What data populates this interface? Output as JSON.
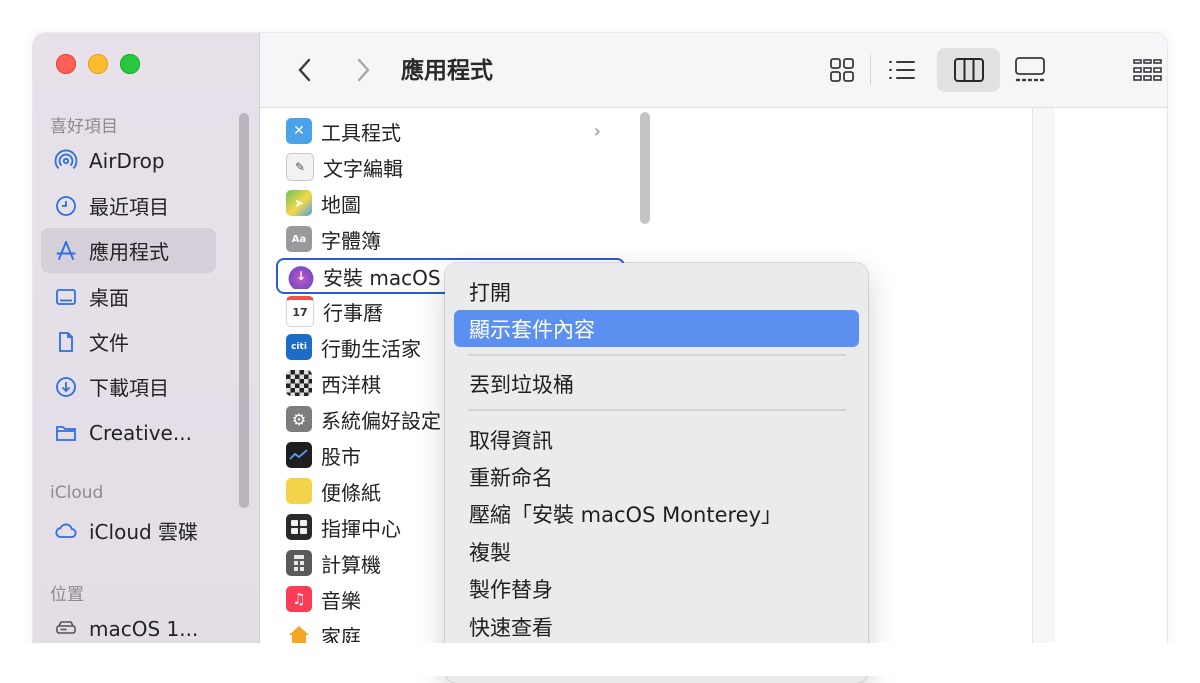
{
  "window": {
    "traffic_lights": {
      "close": "#fe5f57",
      "minimize": "#febc2e",
      "zoom": "#28c840"
    }
  },
  "sidebar": {
    "sections": [
      {
        "title": "喜好項目"
      },
      {
        "title": "iCloud"
      },
      {
        "title": "位置"
      }
    ],
    "items": [
      {
        "label": "AirDrop",
        "icon": "airdrop-icon"
      },
      {
        "label": "最近項目",
        "icon": "clock-icon"
      },
      {
        "label": "應用程式",
        "icon": "apps-icon",
        "selected": true
      },
      {
        "label": "桌面",
        "icon": "desktop-icon"
      },
      {
        "label": "文件",
        "icon": "document-icon"
      },
      {
        "label": "下載項目",
        "icon": "download-icon"
      },
      {
        "label": "Creative...",
        "icon": "folder-icon"
      },
      {
        "label": "iCloud 雲碟",
        "icon": "cloud-icon"
      },
      {
        "label": "macOS 1...",
        "icon": "disk-icon"
      }
    ]
  },
  "toolbar": {
    "title": "應用程式",
    "back": "back-chevron-icon",
    "forward": "forward-chevron-icon",
    "views": [
      "icon-view-icon",
      "list-view-icon",
      "column-view-icon",
      "gallery-view-icon"
    ],
    "selected_view": "column-view-icon",
    "group": "group-icon"
  },
  "files": [
    {
      "name": "工具程式",
      "color": "#4aa3e8"
    },
    {
      "name": "文字編輯",
      "color": "#f2f2f2"
    },
    {
      "name": "地圖",
      "color": "#6cc35a"
    },
    {
      "name": "字體簿",
      "color": "#9a9a9c"
    },
    {
      "name": "安裝 macOS M",
      "color": "#7b4cc2",
      "focused": true
    },
    {
      "name": "行事曆",
      "color": "#ffffff"
    },
    {
      "name": "行動生活家",
      "color": "#1c6cc8"
    },
    {
      "name": "西洋棋",
      "color": "#444444"
    },
    {
      "name": "系統偏好設定",
      "color": "#7d7d80"
    },
    {
      "name": "股市",
      "color": "#1e1e1e"
    },
    {
      "name": "便條紙",
      "color": "#f3d34a"
    },
    {
      "name": "指揮中心",
      "color": "#2a2a2a"
    },
    {
      "name": "計算機",
      "color": "#5a5a5c"
    },
    {
      "name": "音樂",
      "color": "#fa3c54"
    },
    {
      "name": "家庭",
      "color": "#f5a623"
    }
  ],
  "file_extras": {
    "calendar_day": "17",
    "citi_label": "citi"
  },
  "context_menu": {
    "items": [
      {
        "label": "打開"
      },
      {
        "label": "顯示套件內容",
        "highlighted": true
      },
      {
        "label": "丟到垃圾桶"
      },
      {
        "label": "取得資訊"
      },
      {
        "label": "重新命名"
      },
      {
        "label": "壓縮「安裝 macOS Monterey」"
      },
      {
        "label": "複製"
      },
      {
        "label": "製作替身"
      },
      {
        "label": "快速查看"
      }
    ]
  },
  "colors": {
    "accent": "#5b8ff0",
    "focus_ring": "#2c5bd8"
  }
}
